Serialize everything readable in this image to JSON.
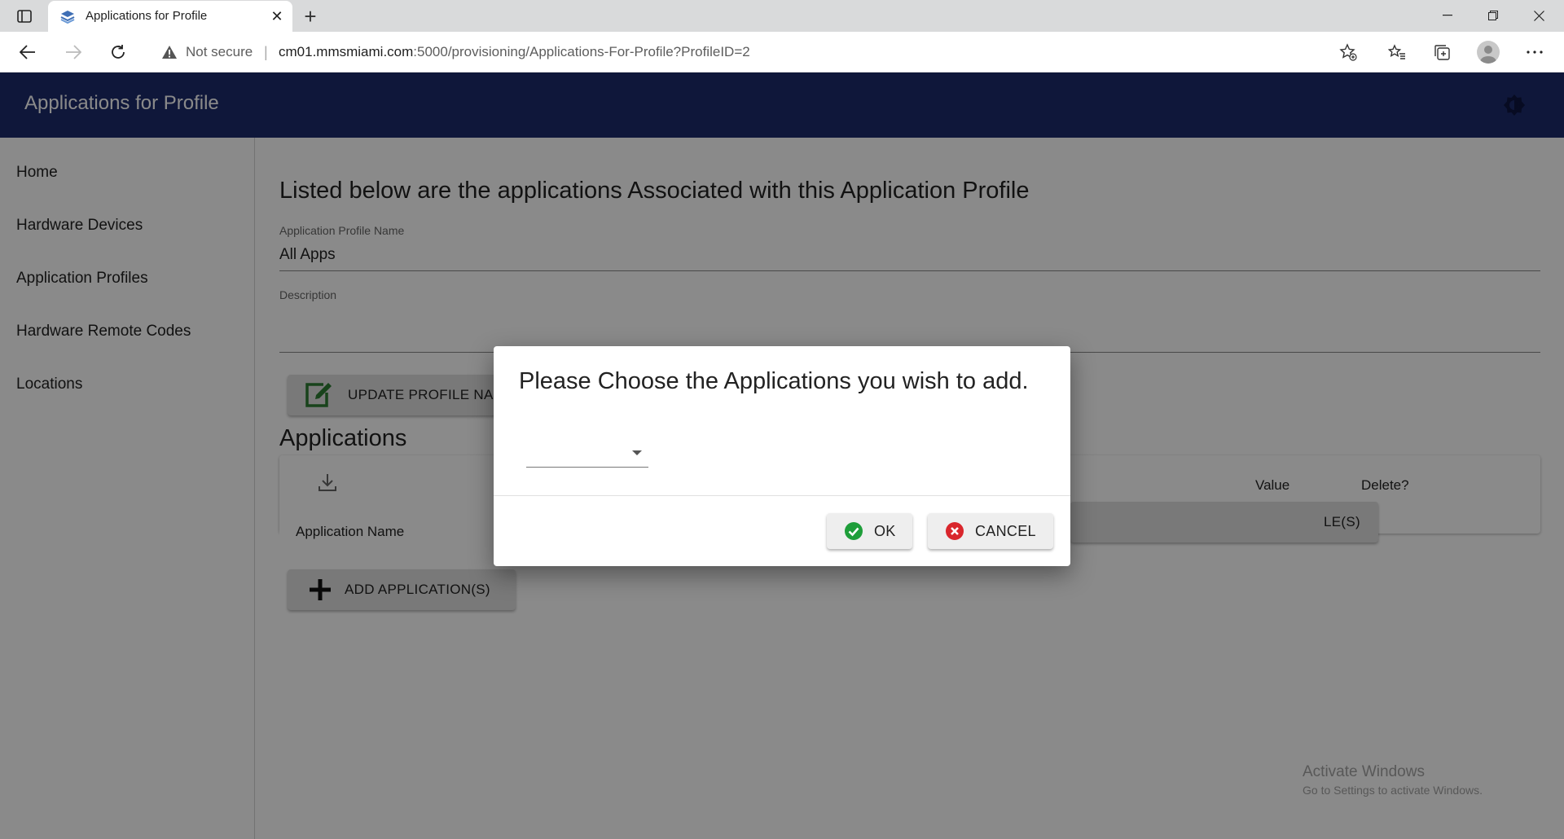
{
  "browser": {
    "tab_title": "Applications for Profile",
    "security_label": "Not secure",
    "url_host": "cm01.mmsmiami.com",
    "url_path": ":5000/provisioning/Applications-For-Profile?ProfileID=2"
  },
  "app": {
    "title": "Applications for Profile"
  },
  "nav": {
    "items": [
      {
        "label": "Home"
      },
      {
        "label": "Hardware Devices"
      },
      {
        "label": "Application Profiles"
      },
      {
        "label": "Hardware Remote Codes"
      },
      {
        "label": "Locations"
      }
    ]
  },
  "main": {
    "heading": "Listed below are the applications Associated with this Application Profile",
    "profile_name_label": "Application Profile Name",
    "profile_name_value": "All Apps",
    "description_label": "Description",
    "description_value": "",
    "update_button": "UPDATE PROFILE NA",
    "applications_title": "Applications",
    "columns": {
      "application_name": "Application Name",
      "value": "Value",
      "delete": "Delete?"
    },
    "hidden_button_tail": "LE(S)",
    "add_button": "ADD APPLICATION(S)"
  },
  "dialog": {
    "title": "Please Choose the Applications you wish to add.",
    "select_value": "",
    "ok_label": "OK",
    "cancel_label": "CANCEL"
  },
  "watermark": {
    "line1": "Activate Windows",
    "line2": "Go to Settings to activate Windows."
  },
  "colors": {
    "app_bar": "#1d2b6b",
    "ok_icon": "#1e9e3a",
    "cancel_icon": "#d9262c",
    "edit_icon": "#2e7d32"
  }
}
